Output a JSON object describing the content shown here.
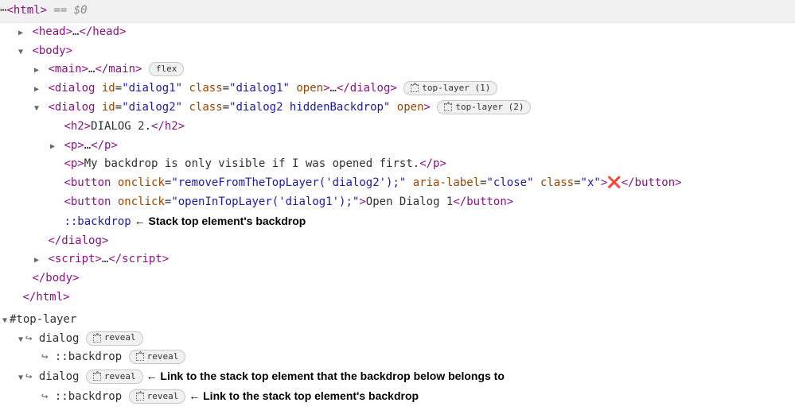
{
  "topbar": {
    "ellipsis": "⋯",
    "html_open": "<html>",
    "eq": " == $0"
  },
  "tree": {
    "head": {
      "open": "<head>",
      "dots": "…",
      "close": "</head>"
    },
    "body_open": "<body>",
    "main": {
      "open": "<main>",
      "dots": "…",
      "close": "</main>",
      "badge": "flex"
    },
    "dialog1": {
      "open_tag": "<dialog",
      "id_attr": " id",
      "id_val": "\"dialog1\"",
      "class_attr": " class",
      "class_val": "\"dialog1\"",
      "open_attr": " open",
      "gt": ">",
      "dots": "…",
      "close": "</dialog>",
      "badge": "top-layer (1)"
    },
    "dialog2": {
      "open_tag": "<dialog",
      "id_attr": " id",
      "id_val": "\"dialog2\"",
      "class_attr": " class",
      "class_val": "\"dialog2 hiddenBackdrop\"",
      "open_attr": " open",
      "gt": ">",
      "badge": "top-layer (2)",
      "h2": {
        "open": "<h2>",
        "text": "DIALOG 2.",
        "close": "</h2>"
      },
      "p1": {
        "open": "<p>",
        "dots": "…",
        "close": "</p>"
      },
      "p2": {
        "open": "<p>",
        "text": "My backdrop is only visible if I was opened first.",
        "close": "</p>"
      },
      "btn1": {
        "open": "<button",
        "onclick_attr": " onclick",
        "onclick_val": "\"removeFromTheTopLayer('dialog2');\"",
        "aria_attr": " aria-label",
        "aria_val": "\"close\"",
        "class_attr": " class",
        "class_val": "\"x\"",
        "gt": ">",
        "x": "❌",
        "close": "</button>"
      },
      "btn2": {
        "open": "<button",
        "onclick_attr": " onclick",
        "onclick_val": "\"openInTopLayer('dialog1');\"",
        "gt": ">",
        "text": "Open Dialog 1",
        "close": "</button>"
      },
      "backdrop_pseudo": "::backdrop",
      "backdrop_anno": " ← Stack top element's backdrop",
      "close_tag": "</dialog>"
    },
    "script": {
      "open": "<script>",
      "dots": "…",
      "close": "</script>"
    },
    "body_close": "</body>",
    "html_close": "</html>"
  },
  "toplayer": {
    "root": "#top-layer",
    "item1": {
      "name": "dialog",
      "reveal": "reveal",
      "backdrop": "::backdrop"
    },
    "item2": {
      "name": "dialog",
      "reveal": "reveal",
      "anno1": " ← Link to the stack top element that the backdrop below belongs to",
      "backdrop": "::backdrop",
      "anno2": " ← Link to the stack top element's backdrop"
    }
  }
}
